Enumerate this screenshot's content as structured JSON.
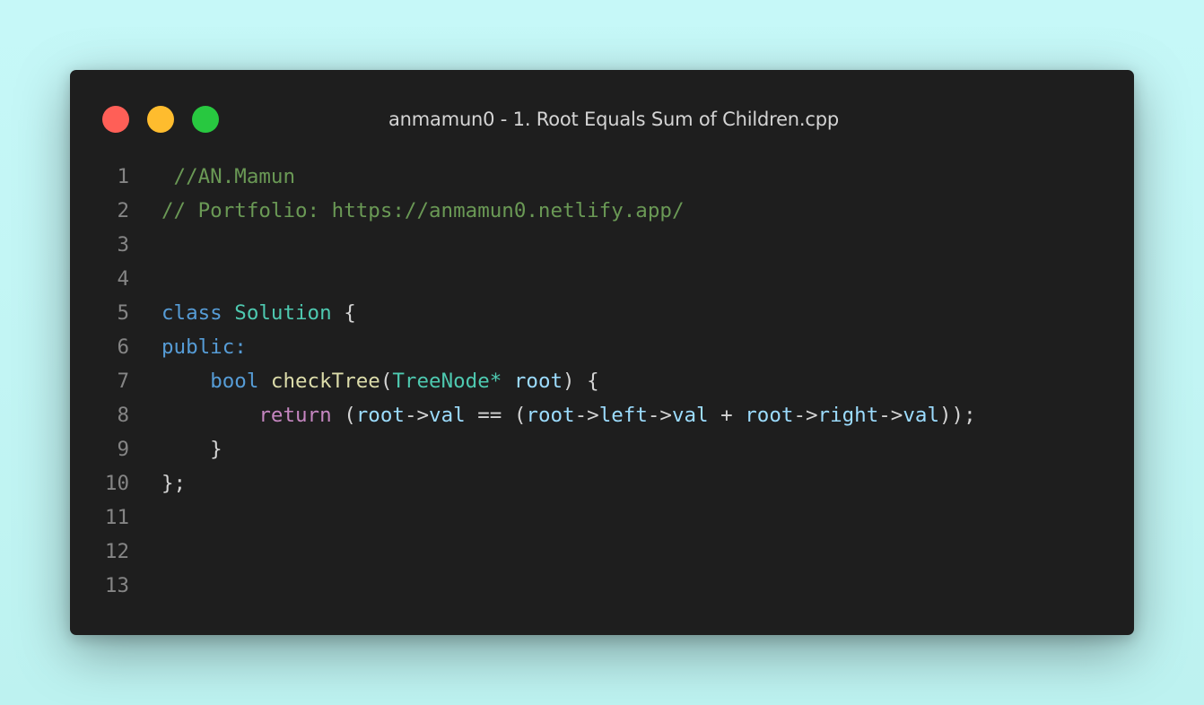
{
  "colors": {
    "background": "#c4f6f6",
    "window": "#1e1e1e",
    "close_dot": "#ff5f57",
    "minimize_dot": "#febc2e",
    "zoom_dot": "#28c840",
    "title_text": "#d4d4d4",
    "line_number": "#858585",
    "token": {
      "comment": "#6a9955",
      "keyword": "#569cd6",
      "control": "#c586c0",
      "type": "#4ec9b0",
      "func": "#dcdcaa",
      "var": "#9cdcfe",
      "punct": "#d4d4d4"
    }
  },
  "window": {
    "title": "anmamun0 - 1. Root Equals Sum of Children.cpp",
    "controls": [
      {
        "name": "close-button",
        "icon": "red-circle"
      },
      {
        "name": "minimize-button",
        "icon": "yellow-circle"
      },
      {
        "name": "zoom-button",
        "icon": "green-circle"
      }
    ]
  },
  "editor": {
    "lines": [
      {
        "num": "1",
        "tokens": [
          {
            "t": " //AN.Mamun",
            "c": "comment"
          }
        ]
      },
      {
        "num": "2",
        "tokens": [
          {
            "t": "// Portfolio: https://anmamun0.netlify.app/",
            "c": "comment"
          }
        ]
      },
      {
        "num": "3",
        "tokens": []
      },
      {
        "num": "4",
        "tokens": []
      },
      {
        "num": "5",
        "tokens": [
          {
            "t": "class",
            "c": "keyword"
          },
          {
            "t": " ",
            "c": "punct"
          },
          {
            "t": "Solution",
            "c": "type"
          },
          {
            "t": " {",
            "c": "punct"
          }
        ]
      },
      {
        "num": "6",
        "tokens": [
          {
            "t": "public:",
            "c": "keyword"
          }
        ]
      },
      {
        "num": "7",
        "tokens": [
          {
            "t": "    ",
            "c": "punct"
          },
          {
            "t": "bool",
            "c": "keyword"
          },
          {
            "t": " ",
            "c": "punct"
          },
          {
            "t": "checkTree",
            "c": "func"
          },
          {
            "t": "(",
            "c": "punct"
          },
          {
            "t": "TreeNode*",
            "c": "type"
          },
          {
            "t": " ",
            "c": "punct"
          },
          {
            "t": "root",
            "c": "var"
          },
          {
            "t": ") {",
            "c": "punct"
          }
        ]
      },
      {
        "num": "8",
        "tokens": [
          {
            "t": "        ",
            "c": "punct"
          },
          {
            "t": "return",
            "c": "control"
          },
          {
            "t": " (",
            "c": "punct"
          },
          {
            "t": "root",
            "c": "var"
          },
          {
            "t": "->",
            "c": "punct"
          },
          {
            "t": "val",
            "c": "var"
          },
          {
            "t": " == (",
            "c": "punct"
          },
          {
            "t": "root",
            "c": "var"
          },
          {
            "t": "->",
            "c": "punct"
          },
          {
            "t": "left",
            "c": "var"
          },
          {
            "t": "->",
            "c": "punct"
          },
          {
            "t": "val",
            "c": "var"
          },
          {
            "t": " + ",
            "c": "punct"
          },
          {
            "t": "root",
            "c": "var"
          },
          {
            "t": "->",
            "c": "punct"
          },
          {
            "t": "right",
            "c": "var"
          },
          {
            "t": "->",
            "c": "punct"
          },
          {
            "t": "val",
            "c": "var"
          },
          {
            "t": "));",
            "c": "punct"
          }
        ]
      },
      {
        "num": "9",
        "tokens": [
          {
            "t": "    }",
            "c": "punct"
          }
        ]
      },
      {
        "num": "10",
        "tokens": [
          {
            "t": "};",
            "c": "punct"
          }
        ]
      },
      {
        "num": "11",
        "tokens": []
      },
      {
        "num": "12",
        "tokens": []
      },
      {
        "num": "13",
        "tokens": []
      }
    ]
  }
}
